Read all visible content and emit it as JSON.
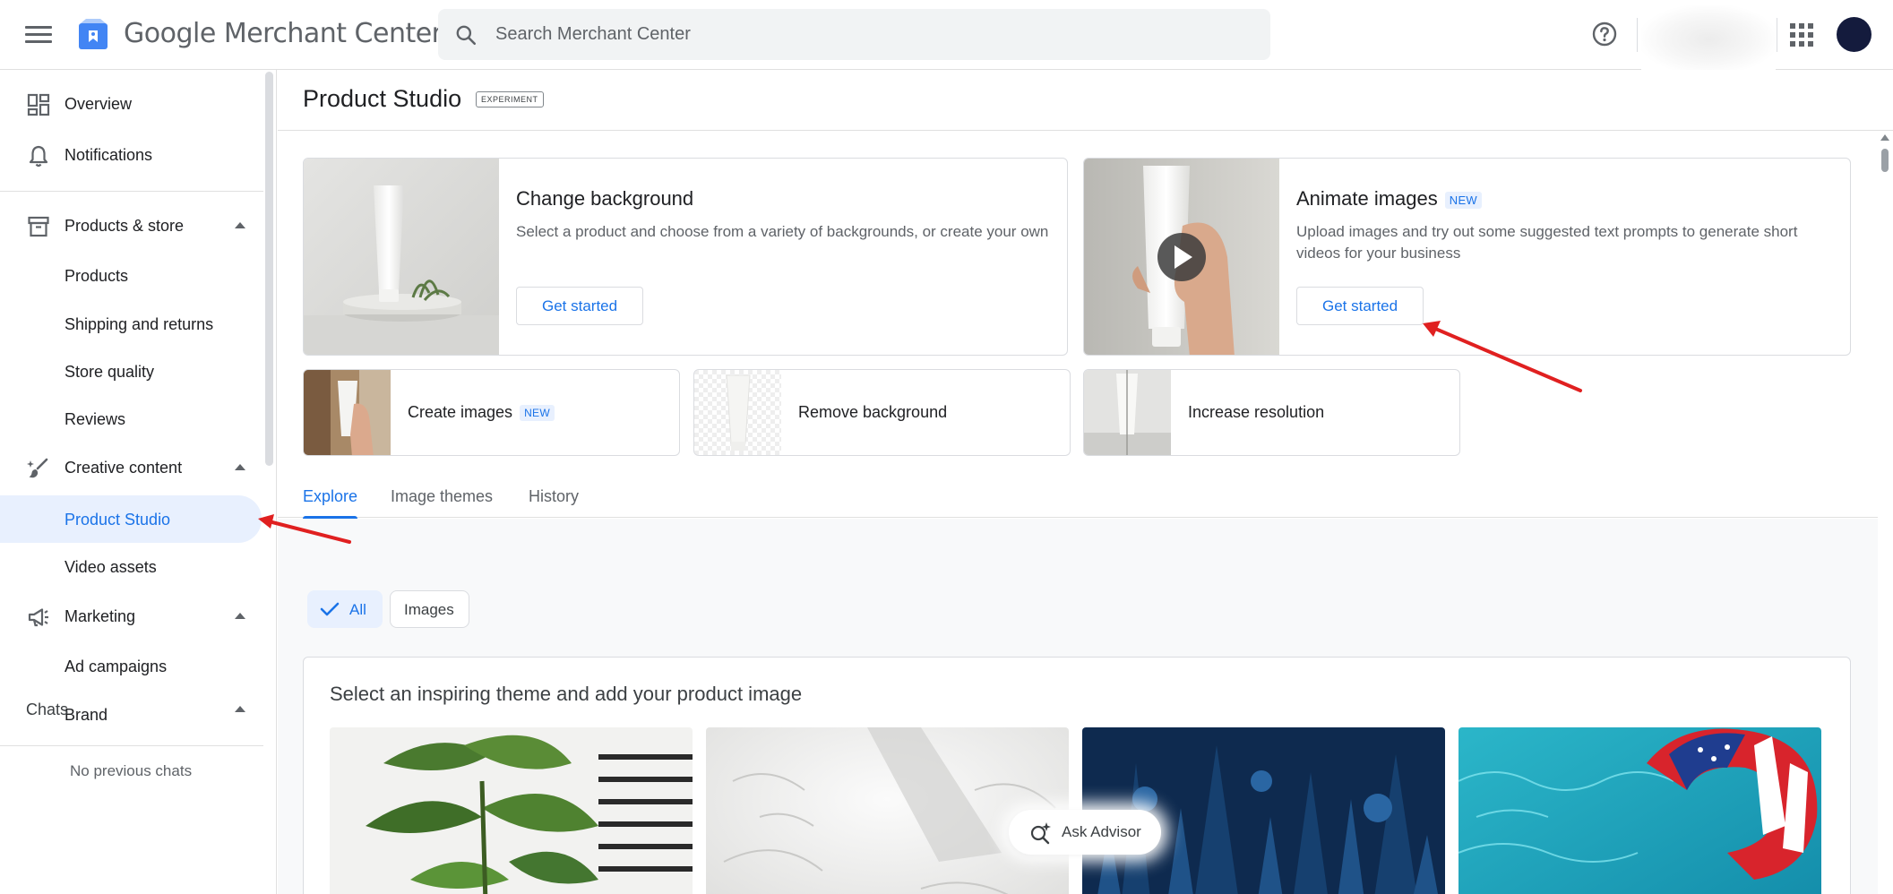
{
  "app": {
    "title": "Google Merchant Center",
    "search_placeholder": "Search Merchant Center",
    "accent_color": "#1a73e8"
  },
  "sidebar": {
    "top_items": [
      {
        "label": "Overview",
        "icon": "dashboard-icon"
      },
      {
        "label": "Notifications",
        "icon": "bell-icon"
      }
    ],
    "sections": [
      {
        "label": "Products & store",
        "icon": "store-icon",
        "expanded": true,
        "items": [
          "Products",
          "Shipping and returns",
          "Store quality",
          "Reviews"
        ]
      },
      {
        "label": "Creative content",
        "icon": "brush-icon",
        "expanded": true,
        "items": [
          "Product Studio",
          "Video assets"
        ]
      },
      {
        "label": "Marketing",
        "icon": "megaphone-icon",
        "expanded": true,
        "items": [
          "Ad campaigns",
          "Brand"
        ]
      }
    ],
    "active_item": "Product Studio",
    "chats": {
      "title": "Chats",
      "empty_text": "No previous chats"
    }
  },
  "page": {
    "title": "Product Studio",
    "badge": "EXPERIMENT"
  },
  "feature_cards": [
    {
      "title": "Change background",
      "badge": "",
      "description": "Select a product and choose from a variety of backgrounds, or create your own",
      "button": "Get started"
    },
    {
      "title": "Animate images",
      "badge": "NEW",
      "description": "Upload images and try out some suggested text prompts to generate short videos for your business",
      "button": "Get started"
    }
  ],
  "tool_cards": [
    {
      "title": "Create images",
      "badge": "NEW"
    },
    {
      "title": "Remove background",
      "badge": ""
    },
    {
      "title": "Increase resolution",
      "badge": ""
    }
  ],
  "tabs": [
    "Explore",
    "Image themes",
    "History"
  ],
  "active_tab": "Explore",
  "filters": [
    {
      "label": "All",
      "selected": true
    },
    {
      "label": "Images",
      "selected": false
    }
  ],
  "themes": {
    "title": "Select an inspiring theme and add your product image",
    "items": [
      "plant-theme-image",
      "white-plaster-theme-image",
      "blue-forest-theme-image",
      "pool-float-theme-image"
    ]
  },
  "advisor_button": "Ask Advisor"
}
